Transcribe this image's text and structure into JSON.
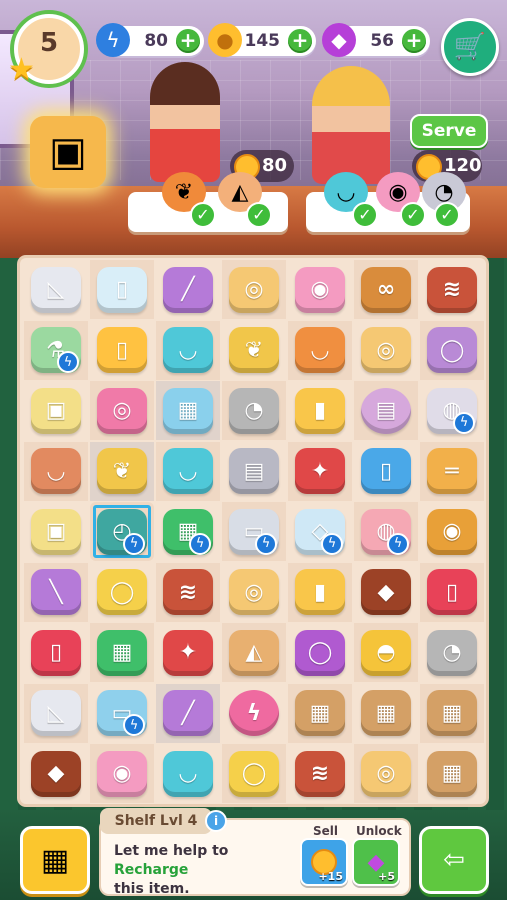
{
  "hud": {
    "level": "5",
    "energy": "80",
    "coins": "145",
    "gems": "56"
  },
  "orders": [
    {
      "reward": "80"
    },
    {
      "reward": "120"
    }
  ],
  "serve_label": "Serve",
  "board": {
    "rows": [
      [
        {
          "n": "napkin-icon",
          "c": "#e6e8ef",
          "g": "◺"
        },
        {
          "n": "milk-glass-icon",
          "c": "#d9eef8",
          "g": "▯"
        },
        {
          "n": "knife-icon",
          "c": "#b57ad8",
          "g": "╱"
        },
        {
          "n": "bread-roll-icon",
          "c": "#f5c873",
          "g": "◎"
        },
        {
          "n": "layer-cake-icon",
          "c": "#f49bc1",
          "g": "◉"
        },
        {
          "n": "pretzel-icon",
          "c": "#d98c3c",
          "g": "∞"
        },
        {
          "n": "bacon-icon",
          "c": "#c9533a",
          "g": "≋"
        }
      ],
      [
        {
          "n": "potion-bottle-icon",
          "c": "#9bd9a0",
          "g": "⚗",
          "b": true
        },
        {
          "n": "orange-juice-icon",
          "c": "#ffc241",
          "g": "▯"
        },
        {
          "n": "mixing-bowl-icon",
          "c": "#4fc8d8",
          "g": "◡"
        },
        {
          "n": "wheat-icon",
          "c": "#f1c64a",
          "g": "❦"
        },
        {
          "n": "soup-bowl-icon",
          "c": "#f08f40",
          "g": "◡"
        },
        {
          "n": "bread-roll-icon",
          "c": "#f5c873",
          "g": "◎"
        },
        {
          "n": "saucepan-icon",
          "c": "#b98ad6",
          "g": "◯"
        }
      ],
      [
        {
          "n": "flour-jar-icon",
          "c": "#f3df88",
          "g": "▣"
        },
        {
          "n": "donut-icon",
          "c": "#f07aa8",
          "g": "◎"
        },
        {
          "n": "ice-bucket-icon",
          "c": "#8ad0ec",
          "g": "▦",
          "web": true
        },
        {
          "n": "spoon-icon",
          "c": "#b6b6b6",
          "g": "◔"
        },
        {
          "n": "beer-mug-icon",
          "c": "#f9c64a",
          "g": "▮"
        },
        {
          "n": "grater-icon",
          "c": "#d6a8dc",
          "g": "▤",
          "bubble": true
        },
        {
          "n": "mixer-bowl-icon",
          "c": "#e0dce8",
          "g": "◍",
          "b": true
        }
      ],
      [
        {
          "n": "purple-bowl-icon",
          "c": "#e28a60",
          "g": "◡"
        },
        {
          "n": "wheat-icon",
          "c": "#f1c64a",
          "g": "❦",
          "web": true
        },
        {
          "n": "mixing-bowl-icon",
          "c": "#4fc8d8",
          "g": "◡"
        },
        {
          "n": "grater-icon",
          "c": "#b8b8c4",
          "g": "▤"
        },
        {
          "n": "hand-mixer-icon",
          "c": "#e04848",
          "g": "✦"
        },
        {
          "n": "milk-carton-icon",
          "c": "#4aa8e8",
          "g": "▯"
        },
        {
          "n": "rolling-pin-icon",
          "c": "#f2b04a",
          "g": "═"
        }
      ],
      [
        {
          "n": "flour-jar-icon",
          "c": "#f3df88",
          "g": "▣"
        },
        {
          "n": "timer-icon",
          "c": "#3fa7a0",
          "g": "◴",
          "b": true,
          "sel": true
        },
        {
          "n": "oven-icon",
          "c": "#3fbf6a",
          "g": "▦",
          "b": true
        },
        {
          "n": "toaster-icon",
          "c": "#d8dde6",
          "g": "▭",
          "b": true
        },
        {
          "n": "ice-cube-icon",
          "c": "#cfe8f6",
          "g": "◇",
          "b": true
        },
        {
          "n": "piggy-bank-icon",
          "c": "#f5a8b4",
          "g": "◍",
          "b": true
        },
        {
          "n": "pie-icon",
          "c": "#e8a038",
          "g": "◉"
        }
      ],
      [
        {
          "n": "spatula-icon",
          "c": "#b57ad8",
          "g": "╲"
        },
        {
          "n": "plate-icon",
          "c": "#f5d04a",
          "g": "◯"
        },
        {
          "n": "bacon-icon",
          "c": "#c9533a",
          "g": "≋"
        },
        {
          "n": "bread-roll-icon",
          "c": "#f5c873",
          "g": "◎"
        },
        {
          "n": "beer-mug-icon",
          "c": "#f9c64a",
          "g": "▮"
        },
        {
          "n": "steak-icon",
          "c": "#9c4226",
          "g": "◆"
        },
        {
          "n": "juice-pitcher-icon",
          "c": "#e84258",
          "g": "▯"
        }
      ],
      [
        {
          "n": "juice-pitcher-icon",
          "c": "#e84258",
          "g": "▯"
        },
        {
          "n": "oven-icon",
          "c": "#3fbf6a",
          "g": "▦"
        },
        {
          "n": "hand-mixer-icon",
          "c": "#e04848",
          "g": "✦"
        },
        {
          "n": "cake-slice-icon",
          "c": "#e8b070",
          "g": "◭"
        },
        {
          "n": "saucepan-icon",
          "c": "#b05ad0",
          "g": "◯"
        },
        {
          "n": "cloche-plate-icon",
          "c": "#f5c43a",
          "g": "◓"
        },
        {
          "n": "spoon-icon",
          "c": "#b6b6b6",
          "g": "◔"
        }
      ],
      [
        {
          "n": "napkin-icon",
          "c": "#e6e8ef",
          "g": "◺"
        },
        {
          "n": "toaster-icon",
          "c": "#8fd0ec",
          "g": "▭",
          "b": true
        },
        {
          "n": "knife-icon",
          "c": "#b57ad8",
          "g": "╱",
          "web": true
        },
        {
          "n": "energy-bubble-icon",
          "c": "#ef6aa0",
          "g": "ϟ",
          "bubble": true
        },
        {
          "n": "cardboard-box-icon",
          "c": "#d4a066",
          "g": "▦"
        },
        {
          "n": "cardboard-box-icon",
          "c": "#d4a066",
          "g": "▦"
        },
        {
          "n": "cardboard-box-stack-icon",
          "c": "#d4a066",
          "g": "▦"
        }
      ],
      [
        {
          "n": "steak-icon",
          "c": "#9c4226",
          "g": "◆"
        },
        {
          "n": "layer-cake-icon",
          "c": "#f49bc1",
          "g": "◉"
        },
        {
          "n": "mixing-bowl-icon",
          "c": "#4fc8d8",
          "g": "◡"
        },
        {
          "n": "plate-icon",
          "c": "#f5d04a",
          "g": "◯"
        },
        {
          "n": "bacon-icon",
          "c": "#c9533a",
          "g": "≋"
        },
        {
          "n": "bread-roll-icon",
          "c": "#f5c873",
          "g": "◎"
        },
        {
          "n": "cardboard-box-icon",
          "c": "#d4a066",
          "g": "▦"
        }
      ]
    ]
  },
  "panel": {
    "title": "Shelf Lvl 4",
    "message_prefix": "Let me help to ",
    "message_highlight": "Recharge",
    "message_suffix": "this item.",
    "sell_label": "Sell",
    "sell_value": "+15",
    "unlock_label": "Unlock",
    "unlock_value": "+5"
  }
}
